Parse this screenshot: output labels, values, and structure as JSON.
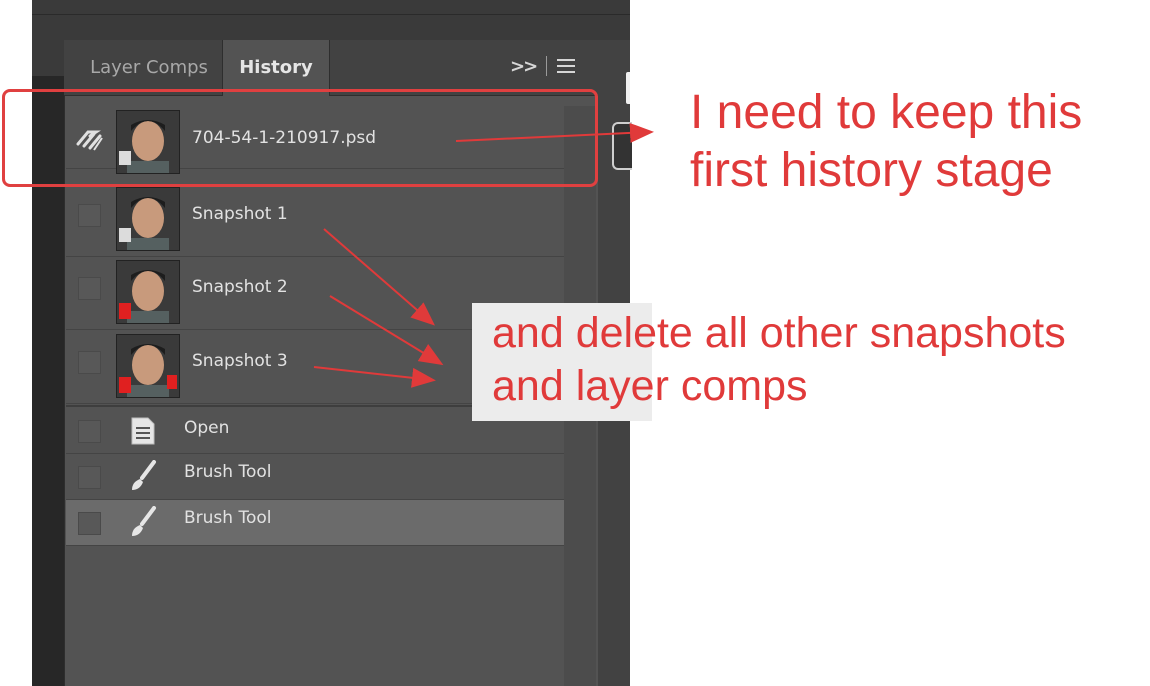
{
  "panel": {
    "tabs": [
      {
        "label": "Layer Comps",
        "active": false
      },
      {
        "label": "History",
        "active": true
      }
    ],
    "icons": [
      "collapse-icon",
      "panel-menu-icon"
    ]
  },
  "snapshots": [
    {
      "label": "704-54-1-210917.psd",
      "icon": "history-source-icon"
    },
    {
      "label": "Snapshot 1"
    },
    {
      "label": "Snapshot 2"
    },
    {
      "label": "Snapshot 3"
    }
  ],
  "history_states": [
    {
      "label": "Open",
      "icon": "document-icon"
    },
    {
      "label": "Brush Tool",
      "icon": "brush-icon"
    },
    {
      "label": "Brush Tool",
      "icon": "brush-icon",
      "selected": true
    }
  ],
  "annotations": {
    "note1_line1": "I need to keep this",
    "note1_line2": "first history stage",
    "note2_line1": "and delete all other snapshots",
    "note2_line2": "and layer comps"
  },
  "colors": {
    "annotation": "#e03a3a",
    "panel_bg": "#535353",
    "selected_row": "#6b6b6b"
  }
}
